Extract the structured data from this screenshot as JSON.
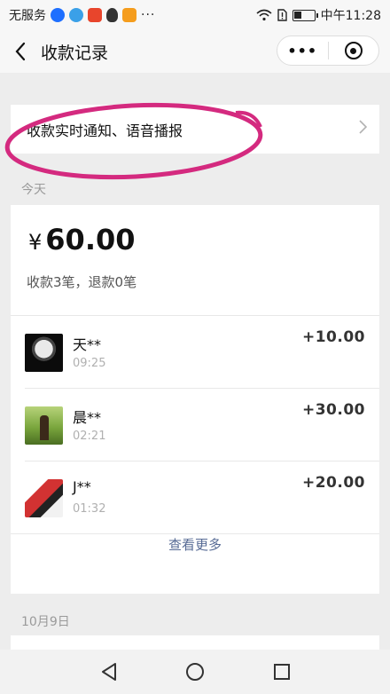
{
  "status_bar": {
    "carrier": "无服务",
    "app_icons": [
      "alipay-icon",
      "app-icon",
      "app-icon",
      "qq-icon",
      "play-icon"
    ],
    "more": "···",
    "time": "中午11:28"
  },
  "nav": {
    "title": "收款记录",
    "capsule_more": "•••"
  },
  "notify": {
    "label": "收款实时通知、语音播报",
    "highlight_color": "#d42a7f"
  },
  "today": {
    "section_label": "今天",
    "currency": "¥",
    "total": "60.00",
    "count_text": "收款3笔，退款0笔",
    "records": [
      {
        "name": "天**",
        "time": "09:25",
        "amount": "+10.00",
        "avatar": "astronaut-avatar"
      },
      {
        "name": "晨**",
        "time": "02:21",
        "amount": "+30.00",
        "avatar": "person-outdoor-avatar"
      },
      {
        "name": "J**",
        "time": "01:32",
        "amount": "+20.00",
        "avatar": "collage-avatar"
      }
    ],
    "view_more": "查看更多"
  },
  "earlier": {
    "section_label": "10月9日"
  },
  "colors": {
    "link": "#576b95",
    "background": "#ededed",
    "card": "#ffffff"
  }
}
